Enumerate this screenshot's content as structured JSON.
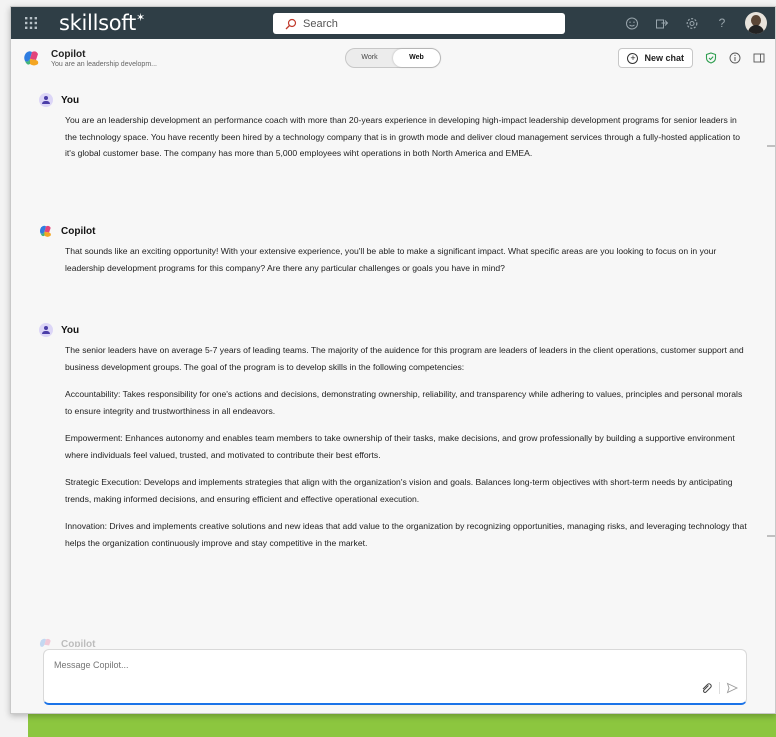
{
  "topbar": {
    "brand": "skillsoft",
    "search_placeholder": "Search"
  },
  "header": {
    "title": "Copilot",
    "subtitle": "You are an leadership developm...",
    "toggle": [
      "Work",
      "Web"
    ],
    "toggle_active": "Web",
    "new_chat_label": "New chat"
  },
  "messages": [
    {
      "author": "You",
      "paragraphs": [
        "You are an leadership development an performance coach with more than 20-years experience in developing high-impact leadership development programs for senior leaders in the technology space.  You have recently been hired by a technology company that is in growth mode and deliver cloud management services through a fully-hosted application to it's global customer base.  The company has more than 5,000 employees wiht operations in both North America and EMEA."
      ]
    },
    {
      "author": "Copilot",
      "paragraphs": [
        "That sounds like an exciting opportunity! With your extensive experience, you'll be able to make a significant impact. What specific areas are you looking to focus on in your leadership development programs for this company? Are there any particular challenges or goals you have in mind?"
      ]
    },
    {
      "author": "You",
      "paragraphs": [
        "The senior leaders have on average 5-7 years of leading teams.  The majority of the auidence for this program are leaders of leaders in the client operations, customer support and business development groups.  The goal of the program is to develop skills in the following competencies:",
        "Accountability: Takes responsibility for one's actions and decisions, demonstrating ownership, reliability, and transparency while adhering to values, principles and personal morals to ensure integrity and trustworthiness in all endeavors.",
        "Empowerment: Enhances autonomy and enables team members to take ownership of their tasks, make decisions, and grow professionally by building a supportive environment where individuals feel valued, trusted, and motivated to contribute their best efforts.",
        "Strategic Execution: Develops and implements strategies that align with the organization's vision and goals. Balances long-term objectives with short-term needs by anticipating trends, making informed decisions, and ensuring efficient and effective operational execution.",
        "Innovation: Drives and implements creative solutions and new ideas that add value to the organization by recognizing opportunities, managing risks, and leveraging technology that helps the organization continuously improve and stay competitive in the market."
      ]
    }
  ],
  "faded_author": "Copilot",
  "composer": {
    "placeholder": "Message Copilot..."
  },
  "colors": {
    "topbar": "#2f3e46",
    "accent": "#1a73e8",
    "green_band": "#8cc63f",
    "shield": "#2e9e4f"
  },
  "icons": [
    "apps-grid-icon",
    "search-icon",
    "emoji-icon",
    "share-icon",
    "settings-gear-icon",
    "help-icon",
    "copilot-logo-icon",
    "new-chat-plus-icon",
    "shield-check-icon",
    "info-icon",
    "sidebar-panel-icon",
    "user-avatar-icon",
    "attach-paperclip-icon",
    "send-icon"
  ]
}
